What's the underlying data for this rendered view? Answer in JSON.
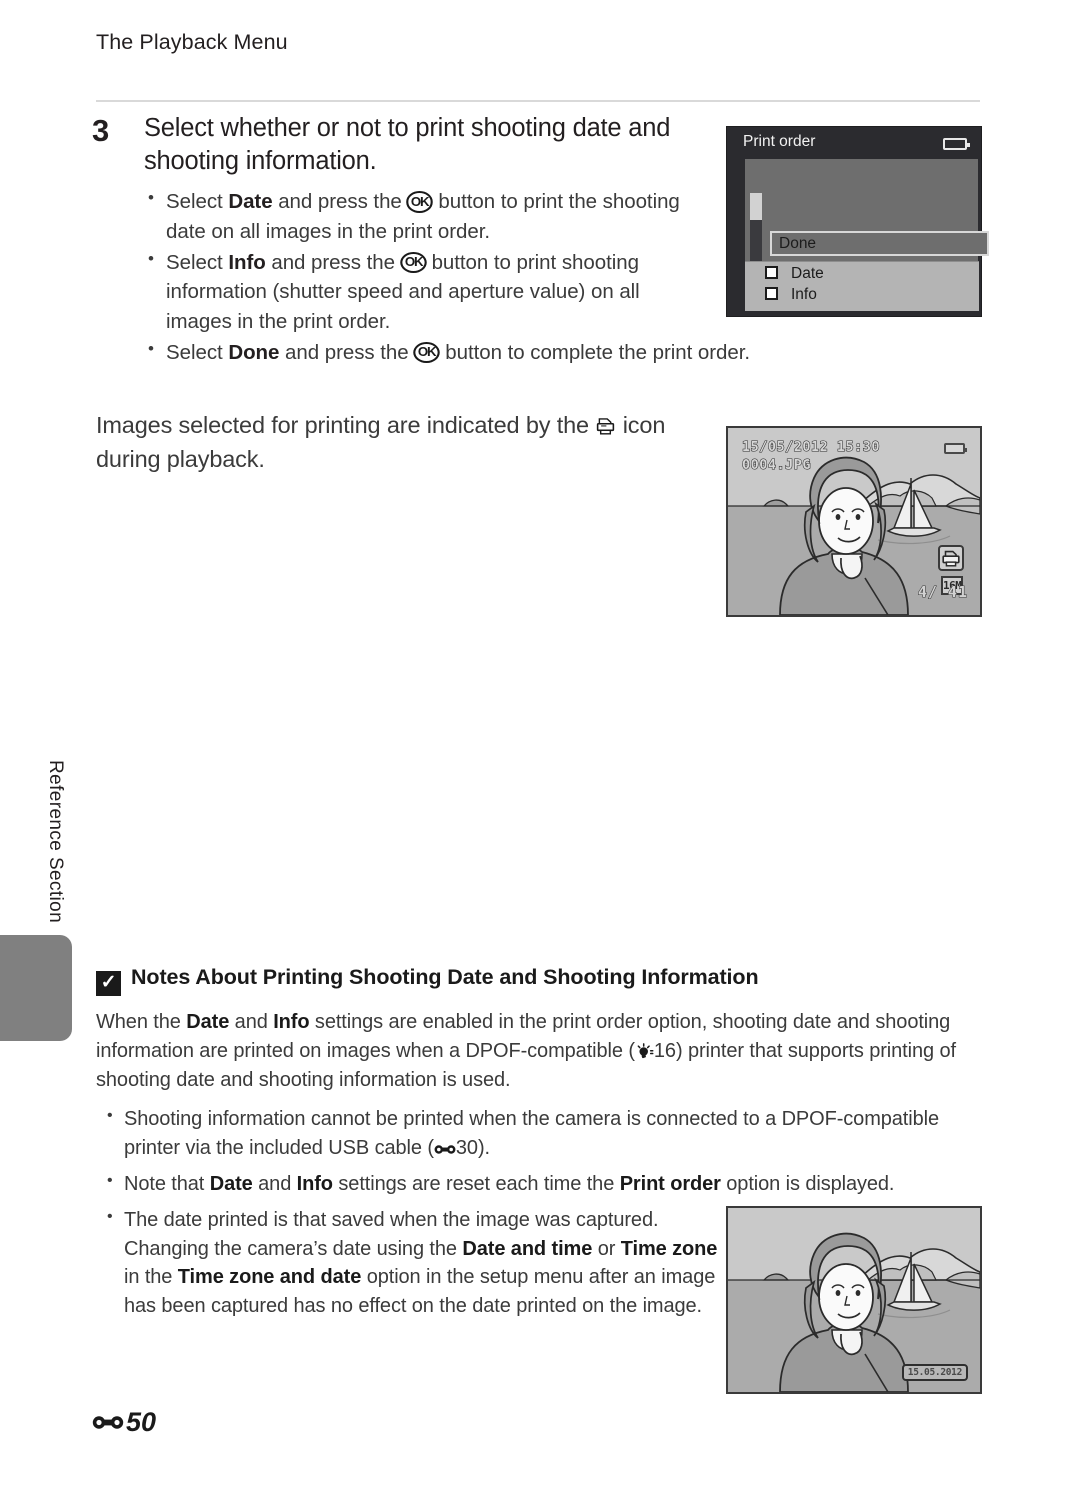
{
  "running_head": "The Playback Menu",
  "step": {
    "number": "3",
    "title": "Select whether or not to print shooting date and shooting information.",
    "bullets": [
      {
        "parts": [
          {
            "t": "Select ",
            "b": false
          },
          {
            "t": "Date",
            "b": true
          },
          {
            "t": " and press the ",
            "b": false
          },
          {
            "t": "OK",
            "icon": "ok-button-icon"
          },
          {
            "t": " button to print the shooting date on all images in the print order.",
            "b": false
          }
        ]
      },
      {
        "parts": [
          {
            "t": "Select ",
            "b": false
          },
          {
            "t": "Info",
            "b": true
          },
          {
            "t": " and press the ",
            "b": false
          },
          {
            "t": "OK",
            "icon": "ok-button-icon"
          },
          {
            "t": " button to print shooting information (shutter speed and aperture value) on all images in the print order.",
            "b": false
          }
        ]
      },
      {
        "parts": [
          {
            "t": "Select ",
            "b": false
          },
          {
            "t": "Done",
            "b": true
          },
          {
            "t": " and press the ",
            "b": false
          },
          {
            "t": "OK",
            "icon": "ok-button-icon"
          },
          {
            "t": " button to complete the print order.",
            "b": false
          }
        ]
      }
    ]
  },
  "mid_paragraph": {
    "before_icon": "Images selected for printing are indicated by the ",
    "icon": "printer-icon",
    "after_icon": " icon during playback."
  },
  "menu_screen": {
    "title": "Print order",
    "battery_icon": "battery-icon",
    "done_label": "Done",
    "checkboxes": [
      {
        "label": "Date",
        "checked": false
      },
      {
        "label": "Info",
        "checked": false
      }
    ]
  },
  "photo_screen_1": {
    "date": "15/05/2012 15:30",
    "filename": "0004.JPG",
    "battery_icon": "battery-icon",
    "print_icon": "print-order-icon",
    "image_size": "16M",
    "counter": "4/   41"
  },
  "photo_screen_2": {
    "date_stamp": "15.05.2012"
  },
  "side_tab": "Reference Section",
  "notes": {
    "icon": "caution-checkmark-icon",
    "heading": "Notes About Printing Shooting Date and Shooting Information",
    "paragraph": [
      {
        "t": "When the ",
        "b": false
      },
      {
        "t": "Date",
        "b": true
      },
      {
        "t": " and ",
        "b": false
      },
      {
        "t": "Info",
        "b": true
      },
      {
        "t": " settings are enabled in the print order option, shooting date and shooting information are printed on images when a DPOF-compatible (",
        "b": false
      },
      {
        "t": "tip",
        "icon": "tip-reference-icon"
      },
      {
        "t": "16) printer that supports printing of shooting date and shooting information is used.",
        "b": false
      }
    ],
    "bullets": [
      {
        "parts": [
          {
            "t": "Shooting information cannot be printed when the camera is connected to a DPOF-compatible printer via the included USB cable (",
            "b": false
          },
          {
            "t": "E",
            "icon": "reference-section-icon"
          },
          {
            "t": "30).",
            "b": false
          }
        ]
      },
      {
        "parts": [
          {
            "t": "Note that ",
            "b": false
          },
          {
            "t": "Date",
            "b": true
          },
          {
            "t": " and ",
            "b": false
          },
          {
            "t": "Info",
            "b": true
          },
          {
            "t": " settings are reset each time the ",
            "b": false
          },
          {
            "t": "Print order",
            "b": true
          },
          {
            "t": " option is displayed.",
            "b": false
          }
        ]
      },
      {
        "parts": [
          {
            "t": "The date printed is that saved when the image was captured. Changing the camera’s date using the ",
            "b": false
          },
          {
            "t": "Date and time",
            "b": true
          },
          {
            "t": " or ",
            "b": false
          },
          {
            "t": "Time zone",
            "b": true
          },
          {
            "t": " in the ",
            "b": false
          },
          {
            "t": "Time zone and date",
            "b": true
          },
          {
            "t": " option in the setup menu after an image has been captured has no effect on the date printed on the image.",
            "b": false
          }
        ]
      }
    ]
  },
  "footer": {
    "icon": "reference-section-icon",
    "page": "50"
  },
  "colors": {
    "text": "#3b3b3b",
    "bold_text": "#1a1a1a",
    "rule": "#d9d9d9",
    "tab_gray": "#808080",
    "screen_body": "#6e6e6e",
    "screen_titlebar": "#2b2b2f",
    "check_panel": "#b4b4b4"
  }
}
